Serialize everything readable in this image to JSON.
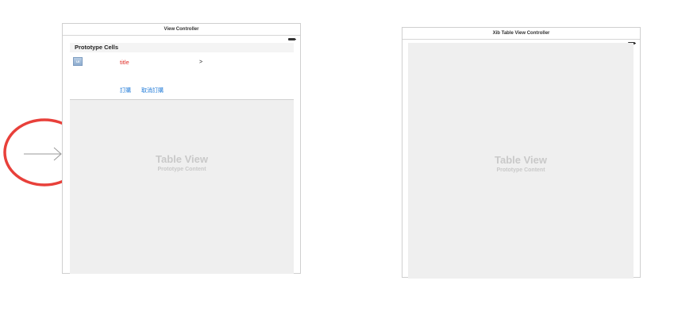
{
  "left_scene": {
    "title": "View Controller",
    "section_header": "Prototype Cells",
    "cell": {
      "image_icon_text": "UIImageView",
      "title": "title",
      "chevron": ">"
    },
    "buttons": {
      "order": "訂購",
      "cancel_order": "取消訂購"
    },
    "table_view_label": "Table View",
    "prototype_content_label": "Prototype Content"
  },
  "right_scene": {
    "title": "Xib Table View Controller",
    "table_view_label": "Table View",
    "prototype_content_label": "Prototype Content"
  },
  "annotation": {
    "circle_color": "#e8403a",
    "arrow_color": "#9a9a9a"
  },
  "colors": {
    "title_text": "#e0302a",
    "button_text": "#1f7ad8",
    "table_bg": "#efefef",
    "placeholder_text": "#c9c9c9"
  }
}
